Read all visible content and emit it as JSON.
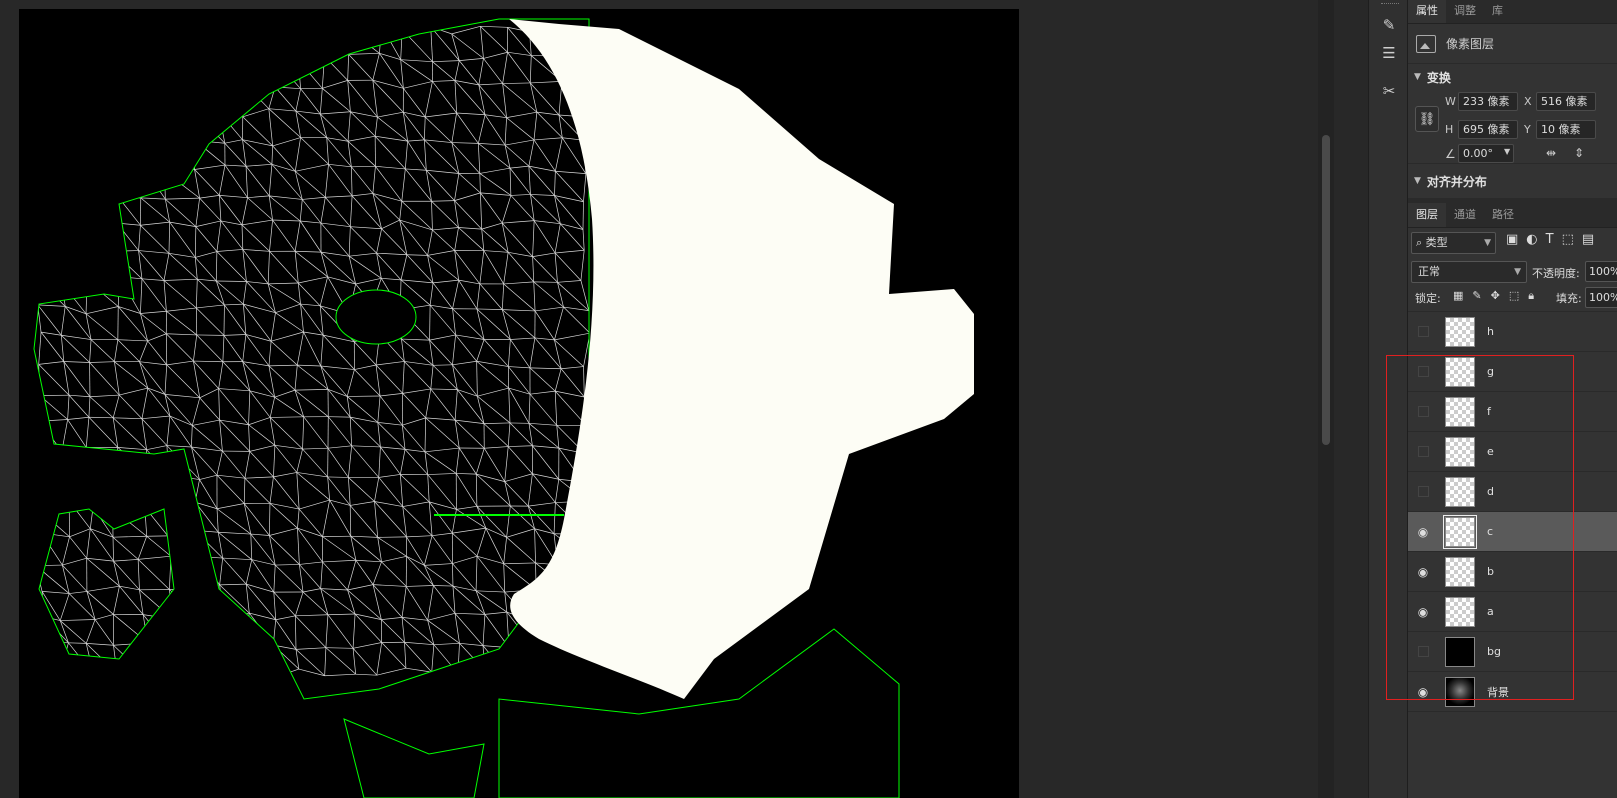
{
  "properties_panel": {
    "tabs": [
      {
        "label": "属性",
        "active": true
      },
      {
        "label": "调整",
        "active": false
      },
      {
        "label": "库",
        "active": false
      }
    ],
    "layer_type_label": "像素图层",
    "transform": {
      "header": "变换",
      "w_label": "W",
      "w_value": "233 像素",
      "h_label": "H",
      "h_value": "695 像素",
      "x_label": "X",
      "x_value": "516 像素",
      "y_label": "Y",
      "y_value": "10 像素",
      "angle_value": "0.00°"
    },
    "align_header": "对齐并分布"
  },
  "layers_panel": {
    "tabs": [
      {
        "label": "图层",
        "active": true
      },
      {
        "label": "通道",
        "active": false
      },
      {
        "label": "路径",
        "active": false
      }
    ],
    "filter_kind": "类型",
    "blend_mode": "正常",
    "opacity_label": "不透明度:",
    "opacity_value": "100%",
    "lock_label": "锁定:",
    "fill_label": "填充:",
    "fill_value": "100%",
    "layers": [
      {
        "name": "h",
        "visible": false,
        "thumb": "transparent",
        "selected": false
      },
      {
        "name": "g",
        "visible": false,
        "thumb": "transparent",
        "selected": false
      },
      {
        "name": "f",
        "visible": false,
        "thumb": "transparent",
        "selected": false
      },
      {
        "name": "e",
        "visible": false,
        "thumb": "transparent",
        "selected": false
      },
      {
        "name": "d",
        "visible": false,
        "thumb": "transparent",
        "selected": false
      },
      {
        "name": "c",
        "visible": true,
        "thumb": "transparent",
        "selected": true
      },
      {
        "name": "b",
        "visible": true,
        "thumb": "transparent",
        "selected": false
      },
      {
        "name": "a",
        "visible": true,
        "thumb": "transparent",
        "selected": false
      },
      {
        "name": "bg",
        "visible": false,
        "thumb": "black",
        "selected": false
      },
      {
        "name": "背景",
        "visible": true,
        "thumb": "mesh",
        "selected": false
      }
    ]
  },
  "icons": {
    "brush": "brush-settings-icon",
    "adjust": "adjust-sliders-icon",
    "tools": "tools-icon",
    "visible": "eye-icon"
  },
  "colors": {
    "canvas_bg": "#000000",
    "mesh_line": "#ffffff",
    "uv_border": "#00ff00",
    "selection_highlight": "#e02020",
    "fill_shape": "#fdfdf5"
  }
}
